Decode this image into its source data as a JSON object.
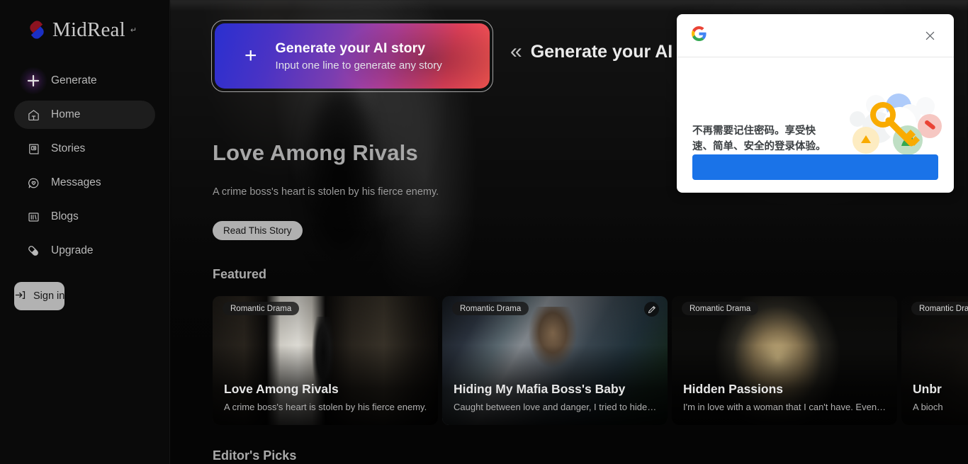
{
  "sidebar": {
    "logo": {
      "text": "MidReal",
      "mark": "↵",
      "icon": "pill-logo-icon"
    },
    "items": [
      {
        "label": "Generate",
        "icon": "plus-icon",
        "active": false
      },
      {
        "label": "Home",
        "icon": "home-icon",
        "active": true
      },
      {
        "label": "Stories",
        "icon": "book-icon",
        "active": false
      },
      {
        "label": "Messages",
        "icon": "chat-heart-icon",
        "active": false
      },
      {
        "label": "Blogs",
        "icon": "blogs-icon",
        "active": false
      },
      {
        "label": "Upgrade",
        "icon": "pill-icon",
        "active": false
      }
    ],
    "sign_in": {
      "label": "Sign in",
      "icon": "login-arrow-icon"
    }
  },
  "cta": {
    "icon": "plus-icon",
    "title": "Generate your AI story",
    "subtitle": "Input one line to generate any story"
  },
  "collapsed_header": {
    "icon": "double-chevron-left-icon",
    "title": "Generate your AI story"
  },
  "hero": {
    "title": "Love Among Rivals",
    "description": "A crime boss's heart is stolen by his fierce enemy.",
    "read_button": "Read This Story"
  },
  "sections": {
    "featured": "Featured",
    "editors_picks": "Editor's Picks"
  },
  "cards": [
    {
      "badge": "Romantic Drama",
      "title": "Love Among Rivals",
      "description": "A crime boss's heart is stolen by his fierce enemy.",
      "has_edit_badge": false
    },
    {
      "badge": "Romantic Drama",
      "title": "Hiding My Mafia Boss's Baby",
      "description": "Caught between love and danger, I tried to hide…",
      "has_edit_badge": true,
      "edit_icon": "pencil-icon"
    },
    {
      "badge": "Romantic Drama",
      "title": "Hidden Passions",
      "description": "I'm in love with a woman that I can't have. Even…",
      "has_edit_badge": false
    },
    {
      "badge": "Romantic Drama",
      "title": "Unbr",
      "description": "A bioch",
      "has_edit_badge": false
    }
  ],
  "google_popup": {
    "logo_icon": "google-g-icon",
    "close_icon": "close-icon",
    "message": "不再需要记住密码。享受快速、简单、安全的登录体验。",
    "illustration_icon": "key-circles-illustration",
    "button_label": ""
  },
  "colors": {
    "accent_blue": "#1a73e8",
    "sidebar_bg": "#0a0a0a",
    "page_bg": "#050505",
    "cta_gradient_start": "#2a2fd0",
    "cta_gradient_end": "#f0534f",
    "signin_bg": "#b2b2b2"
  }
}
